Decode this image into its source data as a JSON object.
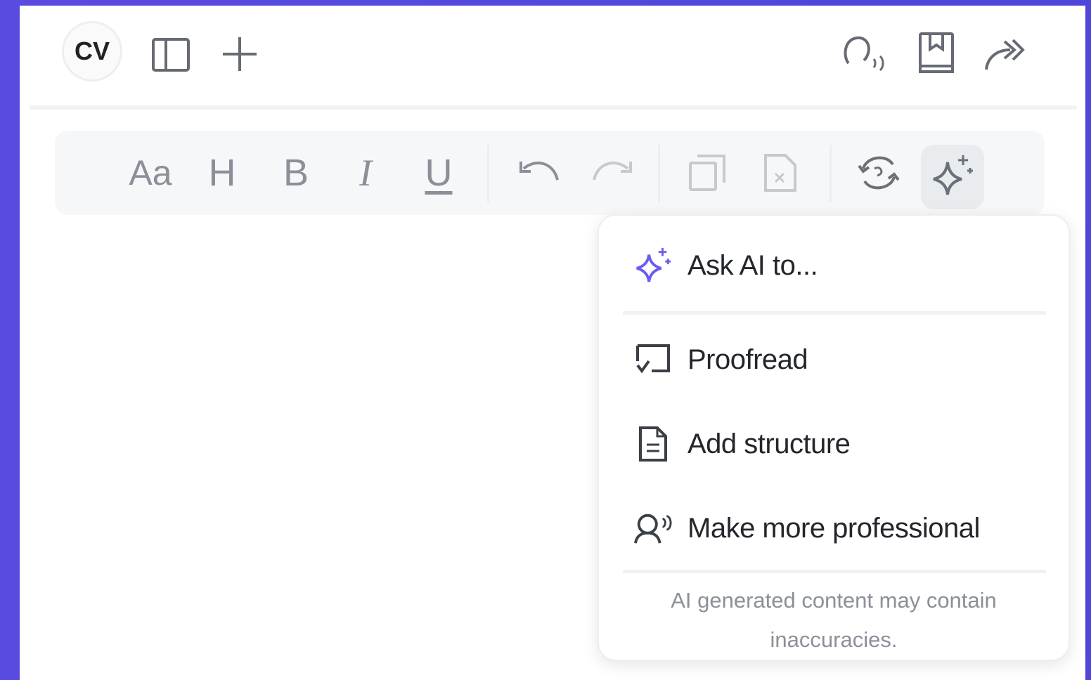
{
  "topbar": {
    "avatar_initials": "CV",
    "icons": [
      "sidebar-toggle-icon",
      "plus-icon",
      "voice-icon",
      "book-icon",
      "share-forward-icon"
    ]
  },
  "toolbar": {
    "text_size_label": "Aa",
    "heading_label": "H",
    "bold_label": "B",
    "italic_label": "I",
    "underline_label": "U",
    "icons": [
      "undo-icon",
      "redo-icon",
      "copy-icon",
      "delete-document-icon",
      "refresh-icon",
      "sparkle-icon"
    ]
  },
  "ai_menu": {
    "items": [
      {
        "label": "Ask AI to...",
        "icon": "sparkle-icon"
      },
      {
        "label": "Proofread",
        "icon": "proofread-icon"
      },
      {
        "label": "Add structure",
        "icon": "document-icon"
      },
      {
        "label": "Make more professional",
        "icon": "speaker-person-icon"
      }
    ],
    "disclaimer": "AI generated content may contain inaccuracies."
  },
  "colors": {
    "background": "#5a4be0",
    "accent": "#6b5cf0",
    "icon_gray": "#8a8f98",
    "text": "#23262b"
  }
}
